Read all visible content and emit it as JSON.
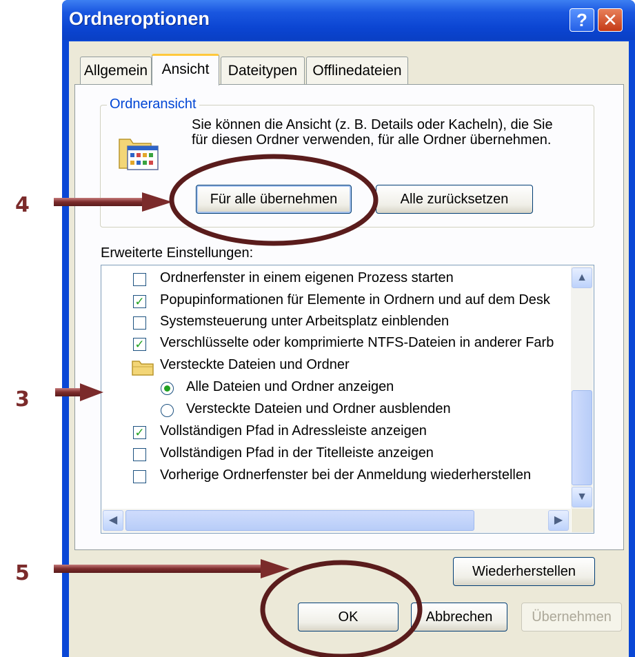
{
  "window": {
    "title": "Ordneroptionen",
    "help_glyph": "?",
    "close_glyph": "✕"
  },
  "tabs": [
    {
      "label": "Allgemein",
      "active": false
    },
    {
      "label": "Ansicht",
      "active": true
    },
    {
      "label": "Dateitypen",
      "active": false
    },
    {
      "label": "Offlinedateien",
      "active": false
    }
  ],
  "folder_view": {
    "legend": "Ordneransicht",
    "description": "Sie können die Ansicht (z. B. Details oder Kacheln), die Sie für diesen Ordner verwenden, für alle Ordner übernehmen.",
    "apply_all_label": "Für alle übernehmen",
    "reset_all_label": "Alle zurücksetzen",
    "icon": "folder-view-icon"
  },
  "advanced": {
    "label": "Erweiterte Einstellungen:",
    "items": [
      {
        "type": "checkbox",
        "checked": false,
        "label": "Ordnerfenster in einem eigenen Prozess starten"
      },
      {
        "type": "checkbox",
        "checked": true,
        "label": "Popupinformationen für Elemente in Ordnern und auf dem Desk"
      },
      {
        "type": "checkbox",
        "checked": false,
        "label": "Systemsteuerung unter Arbeitsplatz einblenden"
      },
      {
        "type": "checkbox",
        "checked": true,
        "label": "Verschlüsselte oder komprimierte NTFS-Dateien in anderer Farb"
      },
      {
        "type": "folder",
        "label": "Versteckte Dateien und Ordner"
      },
      {
        "type": "radio",
        "checked": true,
        "label": "Alle Dateien und Ordner anzeigen"
      },
      {
        "type": "radio",
        "checked": false,
        "label": "Versteckte Dateien und Ordner ausblenden"
      },
      {
        "type": "checkbox",
        "checked": true,
        "label": "Vollständigen Pfad in Adressleiste anzeigen"
      },
      {
        "type": "checkbox",
        "checked": false,
        "label": "Vollständigen Pfad in der Titelleiste anzeigen"
      },
      {
        "type": "checkbox",
        "checked": false,
        "label": "Vorherige Ordnerfenster bei der Anmeldung wiederherstellen"
      }
    ]
  },
  "buttons": {
    "restore": "Wiederherstellen",
    "ok": "OK",
    "cancel": "Abbrechen",
    "apply": "Übernehmen"
  },
  "annotations": {
    "step3": "3",
    "step4": "4",
    "step5": "5",
    "color": "#7b2b2b"
  }
}
